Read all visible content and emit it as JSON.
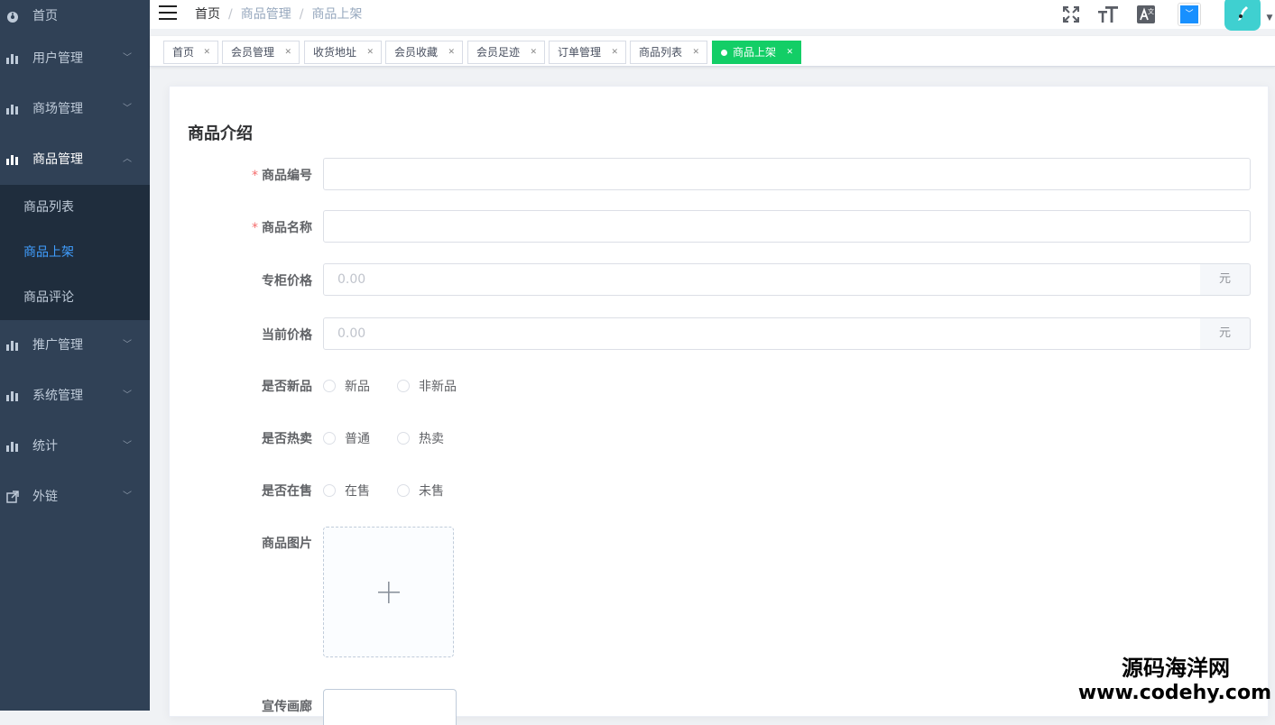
{
  "sidebar": {
    "home": "首页",
    "menus": [
      {
        "label": "用户管理"
      },
      {
        "label": "商场管理"
      },
      {
        "label": "商品管理",
        "expanded": true,
        "children": [
          "商品列表",
          "商品上架",
          "商品评论"
        ],
        "active_child": "商品上架"
      },
      {
        "label": "推广管理"
      },
      {
        "label": "系统管理"
      },
      {
        "label": "统计"
      },
      {
        "label": "外链"
      }
    ]
  },
  "breadcrumb": [
    "首页",
    "商品管理",
    "商品上架"
  ],
  "tags": [
    "首页",
    "会员管理",
    "收货地址",
    "会员收藏",
    "会员足迹",
    "订单管理",
    "商品列表",
    "商品上架"
  ],
  "active_tag": "商品上架",
  "form": {
    "title": "商品介绍",
    "goods_sn_label": "商品编号",
    "goods_name_label": "商品名称",
    "counter_price_label": "专柜价格",
    "counter_price_placeholder": "0.00",
    "retail_price_label": "当前价格",
    "retail_price_placeholder": "0.00",
    "currency_unit": "元",
    "is_new_label": "是否新品",
    "is_new_options": [
      "新品",
      "非新品"
    ],
    "is_hot_label": "是否热卖",
    "is_hot_options": [
      "普通",
      "热卖"
    ],
    "is_on_sale_label": "是否在售",
    "is_on_sale_options": [
      "在售",
      "未售"
    ],
    "pic_label": "商品图片",
    "gallery_label": "宣传画廊"
  },
  "watermark": {
    "line1": "源码海洋网",
    "line2": "www.codehy.com"
  },
  "colors": {
    "sidebar_bg": "#304156",
    "active_tag": "#13ce66",
    "active_menu": "#409eff",
    "required": "#f56c6c"
  }
}
